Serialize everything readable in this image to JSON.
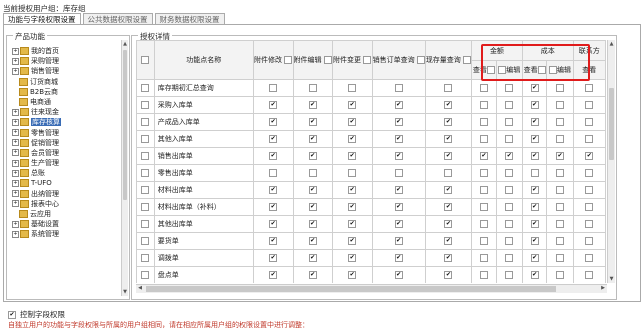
{
  "header": {
    "label": "当前授权用户组：",
    "group": "库存组"
  },
  "tabs": [
    "功能与字段权限设置",
    "公共数据权限设置",
    "财务数据权限设置"
  ],
  "product_panel": {
    "title": "产品功能",
    "tree": [
      {
        "label": "我的首页",
        "expandable": true,
        "color": "yellow"
      },
      {
        "label": "采购管理",
        "expandable": true,
        "color": "yellow"
      },
      {
        "label": "销售管理",
        "expandable": true,
        "color": "yellow"
      },
      {
        "label": "订货商城",
        "expandable": false,
        "color": "yellow"
      },
      {
        "label": "B2B云商",
        "expandable": false,
        "color": "yellow"
      },
      {
        "label": "电商通",
        "expandable": false,
        "color": "yellow"
      },
      {
        "label": "往来现金",
        "expandable": true,
        "color": "yellow"
      },
      {
        "label": "库存核算",
        "expandable": true,
        "color": "yellow",
        "selected": true
      },
      {
        "label": "零售管理",
        "expandable": true,
        "color": "yellow"
      },
      {
        "label": "促销管理",
        "expandable": true,
        "color": "yellow"
      },
      {
        "label": "会员管理",
        "expandable": true,
        "color": "yellow"
      },
      {
        "label": "生产管理",
        "expandable": true,
        "color": "yellow"
      },
      {
        "label": "总账",
        "expandable": true,
        "color": "yellow"
      },
      {
        "label": "T-UFO",
        "expandable": true,
        "color": "yellow"
      },
      {
        "label": "出纳管理",
        "expandable": true,
        "color": "yellow"
      },
      {
        "label": "报表中心",
        "expandable": true,
        "color": "yellow"
      },
      {
        "label": "云应用",
        "expandable": false,
        "color": "yellow"
      },
      {
        "label": "基础设置",
        "expandable": true,
        "color": "yellow"
      },
      {
        "label": "系统管理",
        "expandable": true,
        "color": "yellow"
      }
    ]
  },
  "auth_panel": {
    "title": "授权详情",
    "columns": {
      "name": "功能点名称",
      "groups": [
        "附件修改",
        "附件编辑",
        "附件变更",
        "销售订单查询",
        "现存量查询"
      ],
      "amount": "金额",
      "cost": "成本",
      "cutoff": "联系方",
      "view": "查看",
      "edit": "编辑"
    },
    "rows": [
      {
        "name": "库存期初汇总查询",
        "g": [
          0,
          0,
          0,
          0,
          0
        ],
        "amt": [
          0,
          0
        ],
        "cst": [
          1,
          0
        ],
        "cut": 0
      },
      {
        "name": "采购入库单",
        "g": [
          1,
          1,
          1,
          1,
          1
        ],
        "amt": [
          0,
          0
        ],
        "cst": [
          1,
          0
        ],
        "cut": 0
      },
      {
        "name": "产成品入库单",
        "g": [
          1,
          1,
          1,
          1,
          1
        ],
        "amt": [
          0,
          0
        ],
        "cst": [
          1,
          0
        ],
        "cut": 0
      },
      {
        "name": "其他入库单",
        "g": [
          1,
          1,
          1,
          1,
          1
        ],
        "amt": [
          0,
          0
        ],
        "cst": [
          1,
          0
        ],
        "cut": 0
      },
      {
        "name": "销售出库单",
        "g": [
          1,
          1,
          1,
          1,
          1
        ],
        "amt": [
          1,
          1
        ],
        "cst": [
          1,
          1
        ],
        "cut": 1
      },
      {
        "name": "零售出库单",
        "g": [
          0,
          0,
          0,
          0,
          0
        ],
        "amt": [
          0,
          0
        ],
        "cst": [
          0,
          0
        ],
        "cut": 0
      },
      {
        "name": "材料出库单",
        "g": [
          1,
          1,
          1,
          1,
          1
        ],
        "amt": [
          0,
          0
        ],
        "cst": [
          1,
          0
        ],
        "cut": 0
      },
      {
        "name": "材料出库单（补料）",
        "g": [
          1,
          1,
          1,
          1,
          1
        ],
        "amt": [
          0,
          0
        ],
        "cst": [
          1,
          0
        ],
        "cut": 0
      },
      {
        "name": "其他出库单",
        "g": [
          1,
          1,
          1,
          1,
          1
        ],
        "amt": [
          0,
          0
        ],
        "cst": [
          1,
          0
        ],
        "cut": 0
      },
      {
        "name": "要货单",
        "g": [
          1,
          1,
          1,
          1,
          1
        ],
        "amt": [
          0,
          0
        ],
        "cst": [
          1,
          0
        ],
        "cut": 0
      },
      {
        "name": "调拨单",
        "g": [
          1,
          1,
          1,
          1,
          1
        ],
        "amt": [
          0,
          0
        ],
        "cst": [
          1,
          0
        ],
        "cut": 0
      },
      {
        "name": "盘点单",
        "g": [
          1,
          1,
          1,
          1,
          1
        ],
        "amt": [
          0,
          0
        ],
        "cst": [
          1,
          0
        ],
        "cut": 0
      }
    ]
  },
  "footer": {
    "control_checkbox": "控制字段权限",
    "checked": true,
    "note": "自独立用户的功能与字段权限与所属的用户组相同，请在相应所属用户组的权限设置中进行调整："
  }
}
